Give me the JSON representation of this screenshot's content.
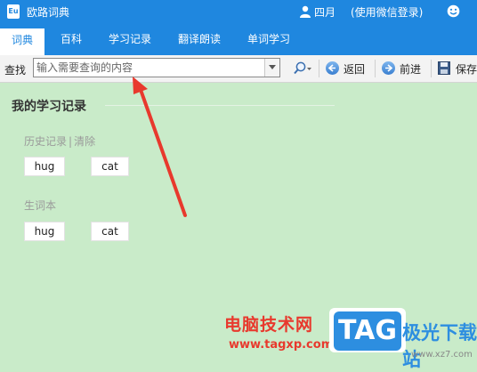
{
  "app": {
    "title": "欧路词典",
    "logo_text": "Eu"
  },
  "user": {
    "name": "四月",
    "login": "(使用微信登录)"
  },
  "tabs": [
    {
      "label": "词典",
      "active": true
    },
    {
      "label": "百科",
      "active": false
    },
    {
      "label": "学习记录",
      "active": false
    },
    {
      "label": "翻译朗读",
      "active": false
    },
    {
      "label": "单词学习",
      "active": false
    }
  ],
  "search": {
    "label": "查找",
    "placeholder": "输入需要查询的内容",
    "value": ""
  },
  "toolbar": {
    "back_label": "返回",
    "forward_label": "前进",
    "save_label": "保存"
  },
  "main": {
    "title": "我的学习记录",
    "history_label": "历史记录",
    "history_sep": "|",
    "clear_label": "清除",
    "history_words": [
      "hug",
      "cat"
    ],
    "vocab_label": "生词本",
    "vocab_words": [
      "hug",
      "cat"
    ]
  },
  "watermark": {
    "text": "电脑技术网",
    "url": "www.tagxp.com",
    "logo": "TAG",
    "site_name": "极光下载站",
    "site_url": "www.xz7.com"
  },
  "colors": {
    "accent": "#1f87df",
    "background": "#c9ebc9",
    "arrow": "#e8392d"
  }
}
